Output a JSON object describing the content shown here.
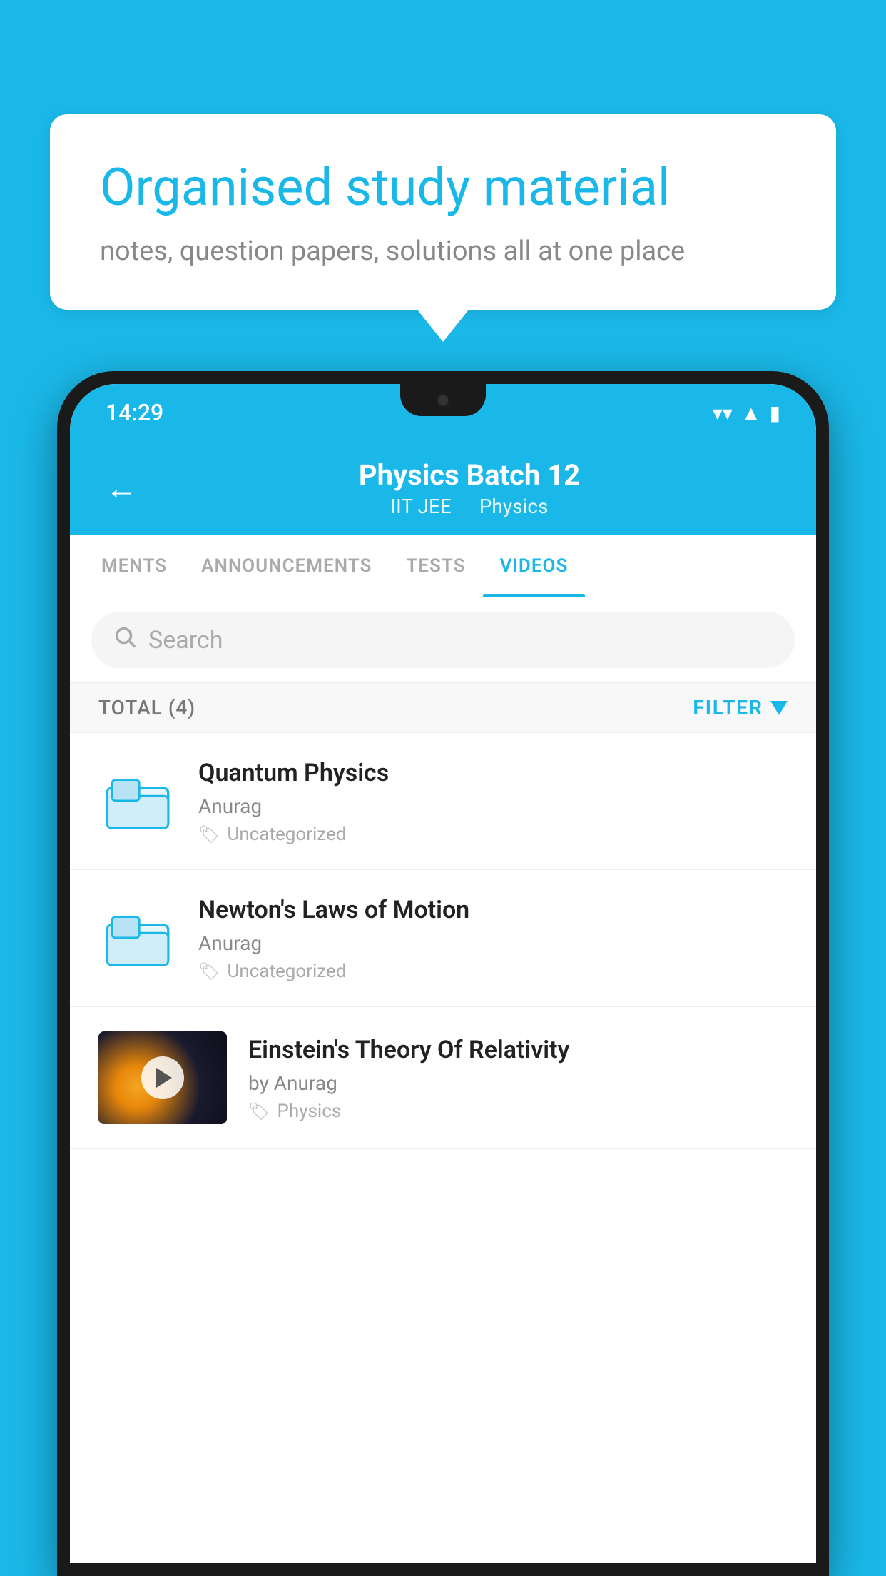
{
  "background": {
    "color": "#1ab8e8"
  },
  "speech_bubble": {
    "title": "Organised study material",
    "subtitle": "notes, question papers, solutions all at one place"
  },
  "status_bar": {
    "time": "14:29",
    "wifi_icon": "wifi",
    "signal_icon": "signal",
    "battery_icon": "battery"
  },
  "app_header": {
    "back_label": "←",
    "title": "Physics Batch 12",
    "subtitle_part1": "IIT JEE",
    "subtitle_part2": "Physics"
  },
  "tabs": [
    {
      "label": "MENTS",
      "active": false
    },
    {
      "label": "ANNOUNCEMENTS",
      "active": false
    },
    {
      "label": "TESTS",
      "active": false
    },
    {
      "label": "VIDEOS",
      "active": true
    }
  ],
  "search": {
    "placeholder": "Search"
  },
  "filter_row": {
    "total_label": "TOTAL (4)",
    "filter_label": "FILTER"
  },
  "video_list": [
    {
      "id": 1,
      "type": "folder",
      "title": "Quantum Physics",
      "author": "Anurag",
      "tag": "Uncategorized"
    },
    {
      "id": 2,
      "type": "folder",
      "title": "Newton's Laws of Motion",
      "author": "Anurag",
      "tag": "Uncategorized"
    },
    {
      "id": 3,
      "type": "video",
      "title": "Einstein's Theory Of Relativity",
      "author": "by Anurag",
      "tag": "Physics"
    }
  ]
}
